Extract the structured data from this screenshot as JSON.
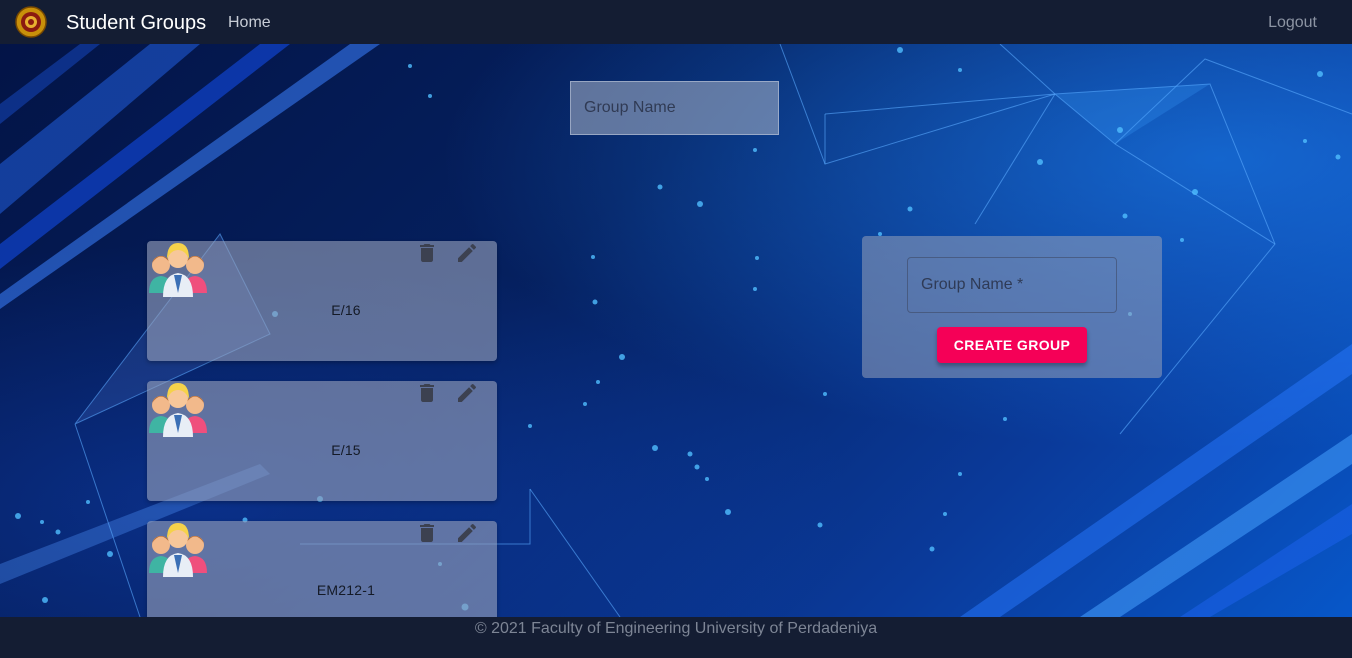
{
  "navbar": {
    "title": "Student Groups",
    "home_label": "Home",
    "logout_label": "Logout",
    "logo_icon": "university-crest-icon"
  },
  "search": {
    "placeholder": "Group Name",
    "value": ""
  },
  "groups": [
    {
      "name": "E/16",
      "avatar_icon": "group-people-icon",
      "delete_icon": "trash-icon",
      "edit_icon": "pencil-icon"
    },
    {
      "name": "E/15",
      "avatar_icon": "group-people-icon",
      "delete_icon": "trash-icon",
      "edit_icon": "pencil-icon"
    },
    {
      "name": "EM212-1",
      "avatar_icon": "group-people-icon",
      "delete_icon": "trash-icon",
      "edit_icon": "pencil-icon"
    }
  ],
  "create_form": {
    "input_placeholder": "Group Name *",
    "input_value": "",
    "button_label": "CREATE GROUP"
  },
  "footer": {
    "text": "© 2021 Faculty of Engineering University of Perdadeniya"
  },
  "colors": {
    "navbar_bg": "#141d33",
    "accent_button": "#f50057",
    "card_bg": "#969fb9"
  }
}
